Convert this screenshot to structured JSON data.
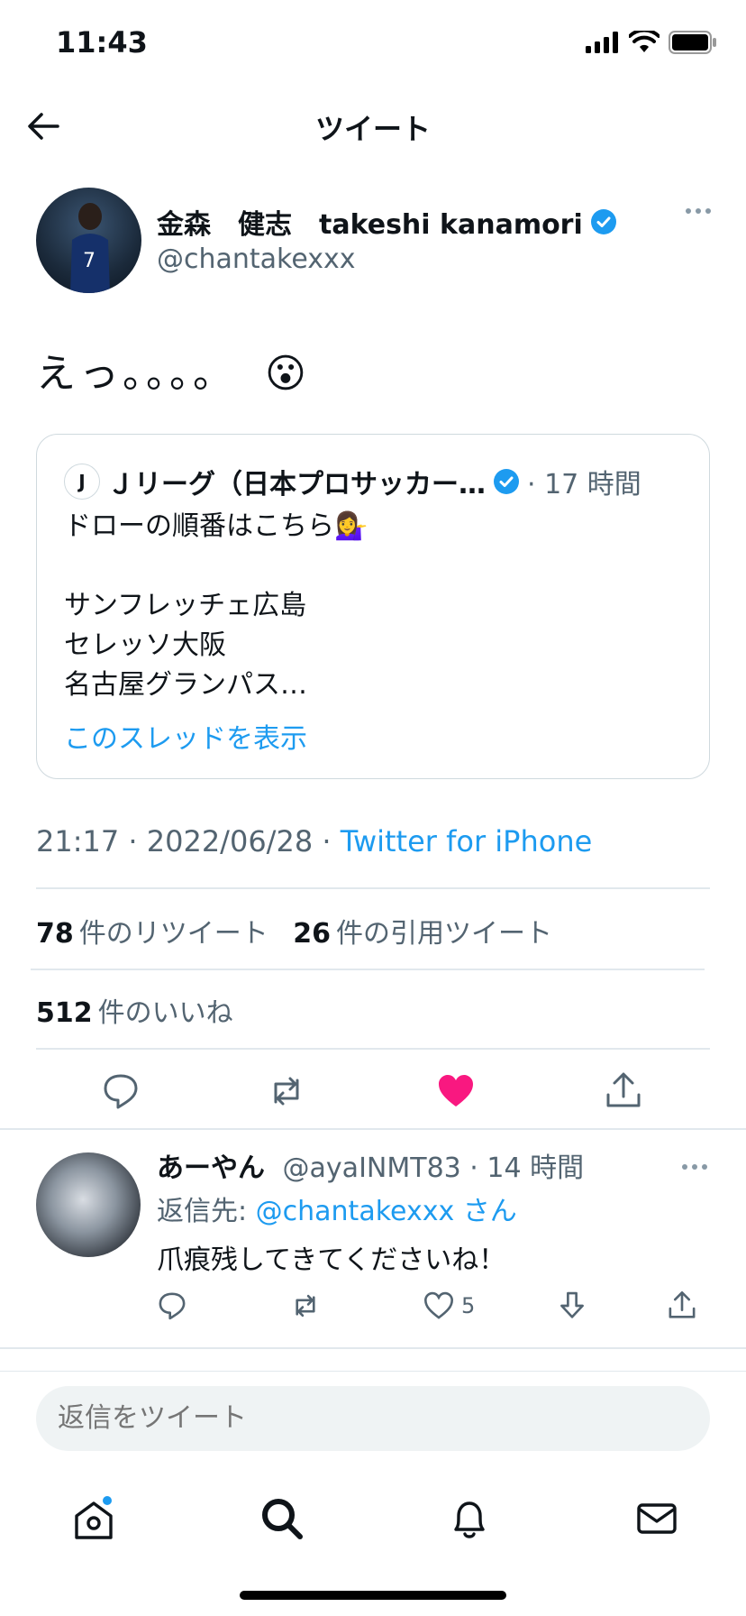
{
  "status_bar": {
    "time": "11:43"
  },
  "nav": {
    "title": "ツイート"
  },
  "tweet": {
    "author_name": "金森　健志　takeshi kanamori",
    "author_handle": "@chantakexxx",
    "text": "えっ。。。。",
    "emoji": "😮",
    "timestamp": "21:17 · 2022/06/28 · ",
    "source": "Twitter for iPhone",
    "retweets_count": "78",
    "retweets_label": "件のリツイート",
    "quotes_count": "26",
    "quotes_label": "件の引用ツイート",
    "likes_count": "512",
    "likes_label": "件のいいね",
    "liked": true
  },
  "quote": {
    "logo_glyph": "J",
    "name": "Ｊリーグ（日本プロサッカー…",
    "meta": "· 17 時間",
    "lines": [
      "ドローの順番はこちら💁‍♀️",
      "",
      "サンフレッチェ広島",
      "セレッソ大阪",
      "名古屋グランパス…"
    ],
    "show_thread": "このスレッドを表示"
  },
  "reply": {
    "name": "あーやん",
    "handle": "@ayaINMT83",
    "meta": " · 14 時間",
    "reply_to_prefix": "返信先: ",
    "reply_to_mention": "@chantakexxx さん",
    "text": "爪痕残してきてくださいね！",
    "like_count": "5"
  },
  "compose": {
    "placeholder": "返信をツイート"
  },
  "colors": {
    "accent": "#1d9bf0",
    "like": "#f91880",
    "verified": "#1d9bf0"
  }
}
